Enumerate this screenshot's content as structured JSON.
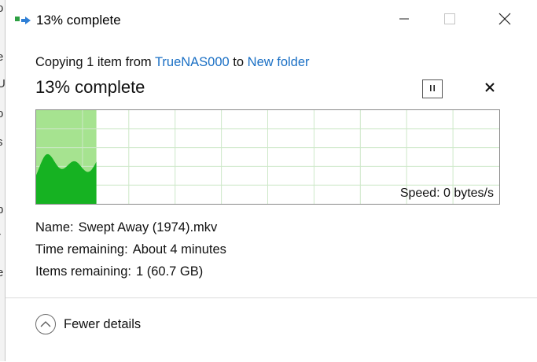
{
  "window": {
    "title": "13% complete",
    "controls": {
      "minimize": "minimize-icon",
      "maximize": "maximize-icon",
      "close": "close-icon"
    }
  },
  "background_fragments": [
    "o",
    "e",
    "U",
    "o",
    "s",
    "i",
    "p",
    "r",
    "e"
  ],
  "copy": {
    "prefix": "Copying 1 item from ",
    "source": "TrueNAS000",
    "middle": " to ",
    "destination": "New folder"
  },
  "status": {
    "percent_text": "13% complete",
    "progress_fraction": 0.13
  },
  "graph": {
    "speed_text": "Speed: 0 bytes/s",
    "colors": {
      "progress_fill": "#a6e390",
      "speed_fill": "#16b222",
      "grid": "#cde8c8"
    }
  },
  "details": {
    "name_label": "Name:",
    "name_value": "Swept Away (1974).mkv",
    "time_label": "Time remaining:",
    "time_value": "About 4 minutes",
    "items_label": "Items remaining:",
    "items_value": "1 (60.7 GB)"
  },
  "footer": {
    "fewer_details_label": "Fewer details",
    "icon": "chevron-up-icon"
  },
  "accent_link_color": "#1a6fc4"
}
